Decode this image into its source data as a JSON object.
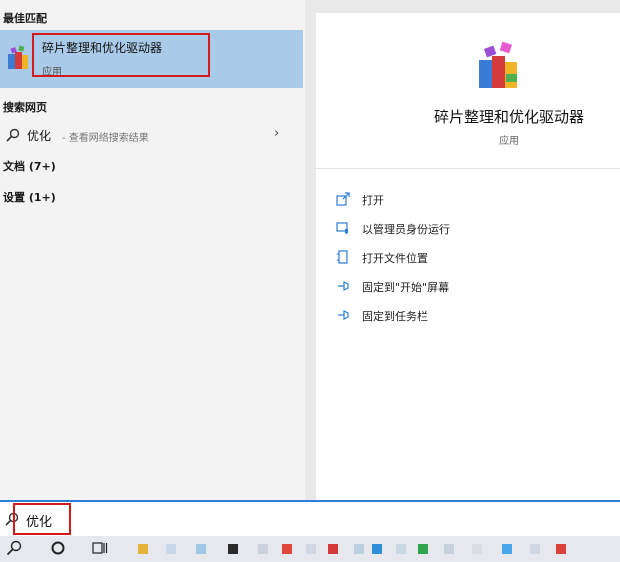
{
  "left": {
    "best_match_heading": "最佳匹配",
    "best_match": {
      "title": "碎片整理和优化驱动器",
      "subtitle": "应用"
    },
    "web_heading": "搜索网页",
    "web_result": {
      "term": "优化",
      "hint": "- 查看网络搜索结果"
    },
    "documents": "文档 (7+)",
    "settings": "设置 (1+)"
  },
  "right": {
    "title": "碎片整理和优化驱动器",
    "subtitle": "应用",
    "actions": [
      "打开",
      "以管理员身份运行",
      "打开文件位置",
      "固定到\"开始\"屏幕",
      "固定到任务栏"
    ]
  },
  "search": {
    "value": "优化"
  },
  "icons": {
    "app": "defrag-app-icon",
    "search": "search-icon",
    "chevron": "chevron-right-icon",
    "open": "open-icon",
    "admin": "shield-run-icon",
    "file_location": "folder-location-icon",
    "pin": "pin-icon",
    "cortana": "cortana-circle-icon",
    "task_view": "task-view-icon"
  },
  "colors": {
    "highlight": "#a9cbe9",
    "annotation": "#d21a1a",
    "accent": "#2b7fd6"
  }
}
